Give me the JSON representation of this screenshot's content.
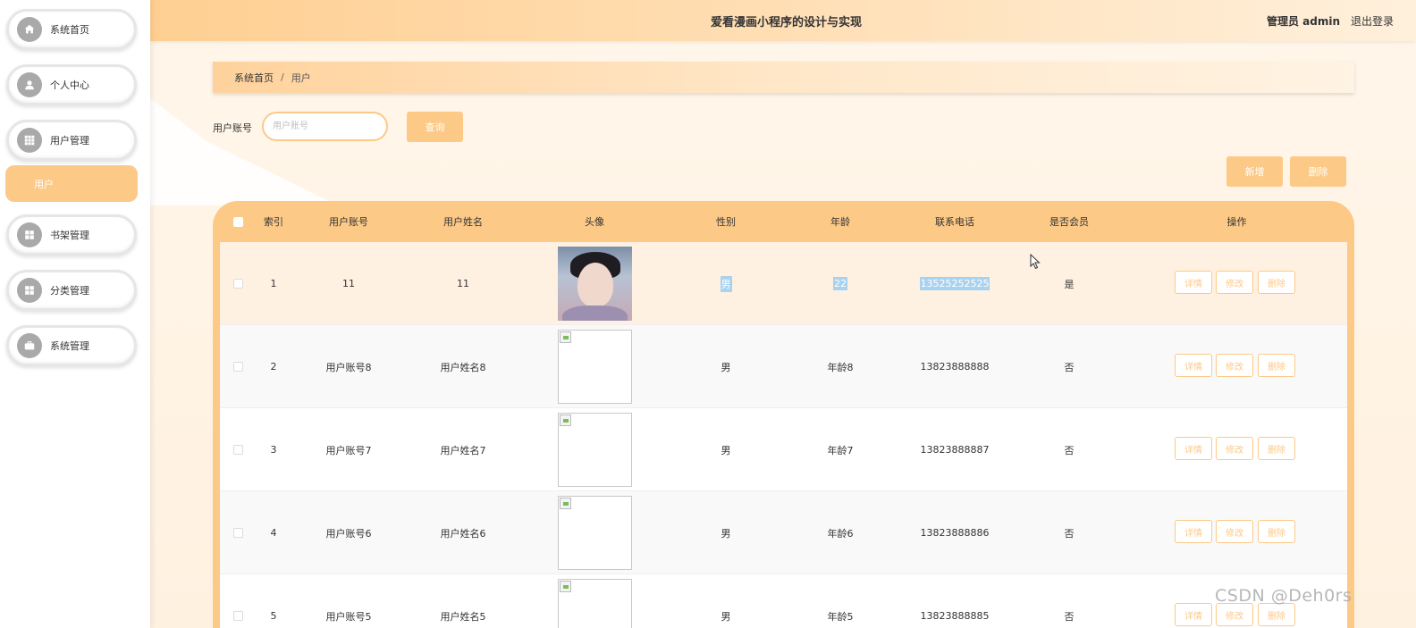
{
  "app": {
    "title": "爱看漫画小程序的设计与实现"
  },
  "header": {
    "admin_label": "管理员 admin",
    "logout_label": "退出登录"
  },
  "sidebar": {
    "items": [
      {
        "label": "系统首页",
        "icon": "home-icon"
      },
      {
        "label": "个人中心",
        "icon": "user-icon"
      },
      {
        "label": "用户管理",
        "icon": "grid-icon"
      },
      {
        "label": "书架管理",
        "icon": "grid-icon"
      },
      {
        "label": "分类管理",
        "icon": "grid-icon"
      },
      {
        "label": "系统管理",
        "icon": "briefcase-icon"
      }
    ],
    "sub_item": "用户"
  },
  "breadcrumb": {
    "home": "系统首页",
    "separator": "/",
    "current": "用户"
  },
  "search": {
    "label": "用户账号",
    "placeholder": "用户账号",
    "button": "查询"
  },
  "actions": {
    "add": "新增",
    "delete": "删除"
  },
  "table": {
    "headers": [
      "索引",
      "用户账号",
      "用户姓名",
      "头像",
      "性别",
      "年龄",
      "联系电话",
      "是否会员",
      "操作"
    ],
    "row_buttons": {
      "detail": "详情",
      "edit": "修改",
      "delete": "删除"
    },
    "rows": [
      {
        "index": "1",
        "account": "11",
        "name": "11",
        "gender": "男",
        "age": "22",
        "phone": "13525252525",
        "member": "是"
      },
      {
        "index": "2",
        "account": "用户账号8",
        "name": "用户姓名8",
        "gender": "男",
        "age": "年龄8",
        "phone": "13823888888",
        "member": "否"
      },
      {
        "index": "3",
        "account": "用户账号7",
        "name": "用户姓名7",
        "gender": "男",
        "age": "年龄7",
        "phone": "13823888887",
        "member": "否"
      },
      {
        "index": "4",
        "account": "用户账号6",
        "name": "用户姓名6",
        "gender": "男",
        "age": "年龄6",
        "phone": "13823888886",
        "member": "否"
      },
      {
        "index": "5",
        "account": "用户账号5",
        "name": "用户姓名5",
        "gender": "男",
        "age": "年龄5",
        "phone": "13823888885",
        "member": "否"
      }
    ]
  },
  "watermark": "CSDN @Deh0rs",
  "colors": {
    "accent": "#fcc987",
    "selection": "#a9d2ef"
  }
}
